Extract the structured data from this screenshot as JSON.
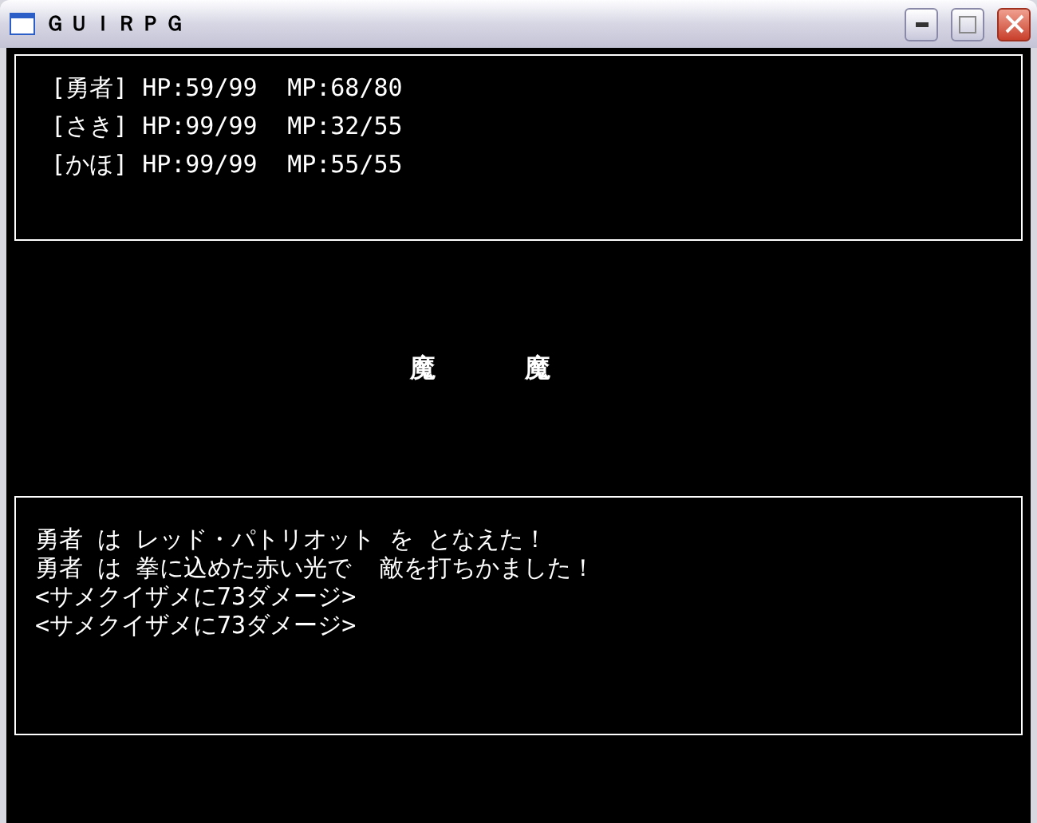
{
  "window": {
    "title": "ＧＵＩＲＰＧ"
  },
  "party": [
    {
      "name": "[勇者]",
      "hp": "HP:59/99",
      "mp": "MP:68/80"
    },
    {
      "name": "[さき]",
      "hp": "HP:99/99",
      "mp": "MP:32/55"
    },
    {
      "name": "[かほ]",
      "hp": "HP:99/99",
      "mp": "MP:55/55"
    }
  ],
  "enemies": [
    "魔",
    "魔"
  ],
  "messages": [
    "勇者 は レッド・パトリオット を となえた！",
    "勇者 は 拳に込めた赤い光で  敵を打ちかました！",
    "<サメクイザメに73ダメージ>",
    "<サメクイザメに73ダメージ>"
  ]
}
